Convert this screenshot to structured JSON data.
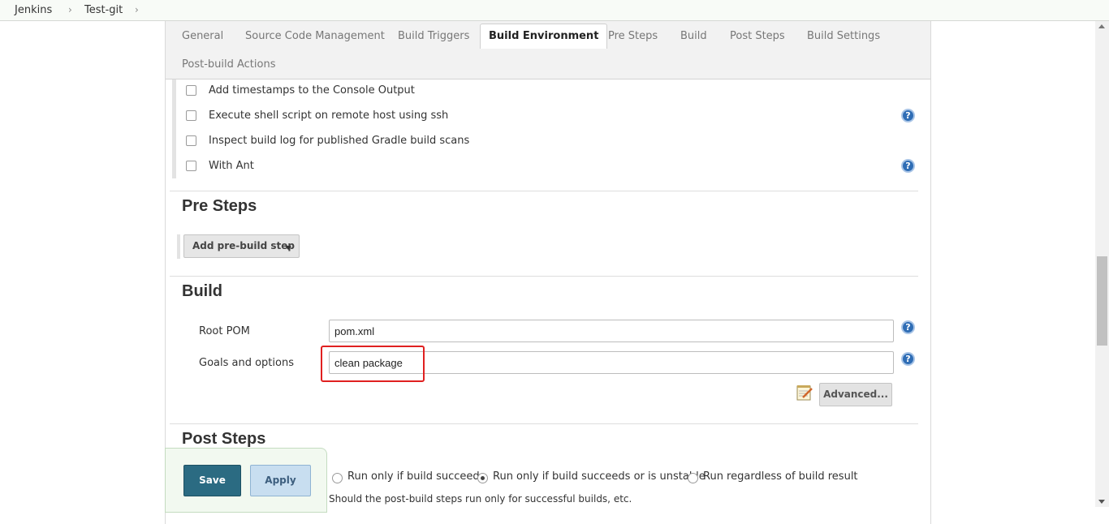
{
  "breadcrumb": {
    "items": [
      "Jenkins",
      "Test-git"
    ],
    "separator": "›"
  },
  "tabs": [
    {
      "label": "General",
      "active": false
    },
    {
      "label": "Source Code Management",
      "active": false
    },
    {
      "label": "Build Triggers",
      "active": false
    },
    {
      "label": "Build Environment",
      "active": true
    },
    {
      "label": "Pre Steps",
      "active": false
    },
    {
      "label": "Build",
      "active": false
    },
    {
      "label": "Post Steps",
      "active": false
    },
    {
      "label": "Build Settings",
      "active": false
    },
    {
      "label": "Post-build Actions",
      "active": false
    }
  ],
  "build_environment": {
    "options": [
      {
        "label": "Add timestamps to the Console Output",
        "checked": false,
        "help": false
      },
      {
        "label": "Execute shell script on remote host using ssh",
        "checked": false,
        "help": true
      },
      {
        "label": "Inspect build log for published Gradle build scans",
        "checked": false,
        "help": false
      },
      {
        "label": "With Ant",
        "checked": false,
        "help": true
      }
    ]
  },
  "pre_steps": {
    "title": "Pre Steps",
    "add_button": "Add pre-build step"
  },
  "build": {
    "title": "Build",
    "root_pom": {
      "label": "Root POM",
      "value": "pom.xml"
    },
    "goals": {
      "label": "Goals and options",
      "value": "clean package"
    },
    "advanced_button": "Advanced..."
  },
  "post_steps": {
    "title": "Post Steps",
    "options": [
      {
        "label": "Run only if build succeeds",
        "checked": false
      },
      {
        "label": "Run only if build succeeds or is unstable",
        "checked": true
      },
      {
        "label": "Run regardless of build result",
        "checked": false
      }
    ],
    "hint": "Should the post-build steps run only for successful builds, etc."
  },
  "actions": {
    "save": "Save",
    "apply": "Apply"
  },
  "help_glyph": "?",
  "colors": {
    "accent": "#2b6b82",
    "help": "#2f6db5",
    "highlight": "#e02020"
  }
}
